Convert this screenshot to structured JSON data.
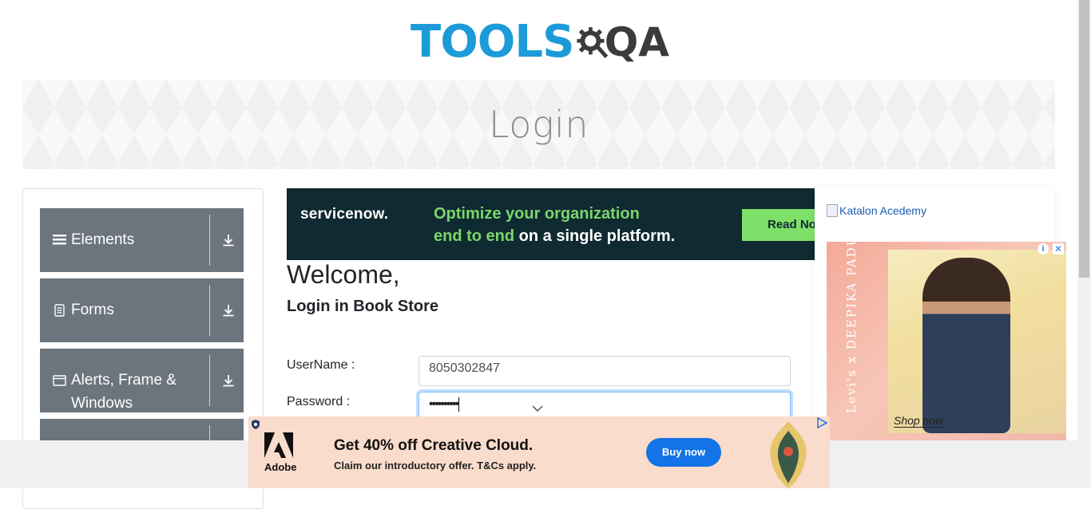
{
  "header": {
    "logo_tools": "TOOLS",
    "logo_qa": "QA"
  },
  "banner": {
    "title": "Login"
  },
  "sidebar": {
    "groups": [
      {
        "label": "Elements",
        "icon": "hamburger-icon"
      },
      {
        "label": "Forms",
        "icon": "document-icon"
      },
      {
        "label": "Alerts, Frame & Windows",
        "icon": "window-icon"
      }
    ]
  },
  "ads": {
    "servicenow": {
      "logo": "servicenow.",
      "line1": "Optimize your organization",
      "line2_green": "end to end",
      "line2_rest": " on a single platform.",
      "button": "Read Now"
    },
    "katalon_alt": "Katalon Acedemy",
    "levis": {
      "brand_text": "Levi's x DEEPIKA PADUKONE",
      "cta": "Shop now"
    },
    "adobe": {
      "brand": "Adobe",
      "headline": "Get 40% off Creative Cloud.",
      "subline": "Claim our introductory offer. T&Cs apply.",
      "button": "Buy now"
    }
  },
  "login": {
    "welcome": "Welcome,",
    "subtitle": "Login in Book Store",
    "username_label": "UserName :",
    "username_value": "8050302847",
    "password_label": "Password :",
    "password_value": "••••••••••"
  },
  "colors": {
    "brand_blue": "#1c9bd8",
    "menu_gray": "#6c757d",
    "servicenow_bg": "#0f2a30",
    "servicenow_green": "#7ee068",
    "adobe_bg": "#f9dccb",
    "adobe_button": "#1473e6"
  }
}
